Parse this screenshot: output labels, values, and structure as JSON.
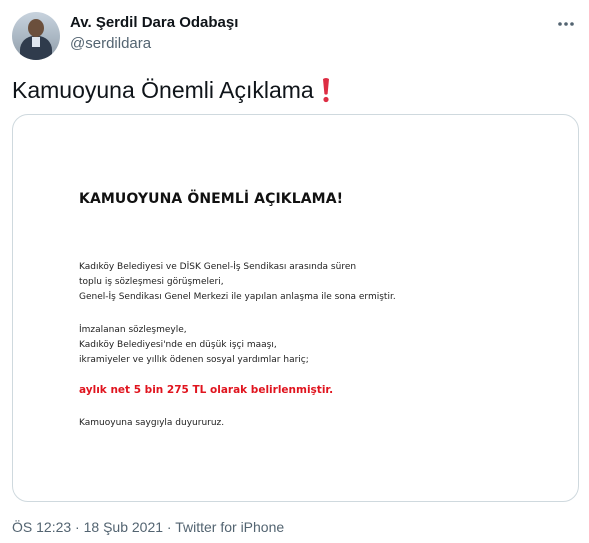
{
  "author": {
    "display_name": "Av. Şerdil Dara Odabaşı",
    "handle": "@serdildara"
  },
  "tweet": {
    "text": "Kamuoyuna Önemli Açıklama",
    "emoji": "heavy-exclamation-mark"
  },
  "image": {
    "title": "KAMUOYUNA ÖNEMLİ AÇIKLAMA!",
    "paragraph1": [
      "Kadıköy Belediyesi ve DİSK Genel-İş Sendikası arasında süren",
      "toplu iş sözleşmesi görüşmeleri,",
      "Genel-İş Sendikası Genel Merkezi ile yapılan anlaşma ile sona ermiştir."
    ],
    "paragraph2": [
      "İmzalanan sözleşmeyle,",
      "Kadıköy Belediyesi'nde en düşük işçi maaşı,",
      "ikramiyeler ve yıllık ödenen sosyal yardımlar hariç;"
    ],
    "highlight": "aylık net 5 bin 275 TL olarak belirlenmiştir.",
    "closing": "Kamuoyuna saygıyla duyururuz."
  },
  "meta": {
    "time": "ÖS 12:23",
    "separator1": "·",
    "date": "18 Şub 2021",
    "separator2": "·",
    "source": "Twitter for iPhone"
  },
  "colors": {
    "text": "#0f1419",
    "secondary": "#536471",
    "border": "#cfd9de",
    "highlight_red": "#e0141e",
    "emoji_red": "#dd2e44"
  },
  "icons": {
    "more": "more-horizontal-icon",
    "emoji": "exclamation-mark-icon"
  }
}
